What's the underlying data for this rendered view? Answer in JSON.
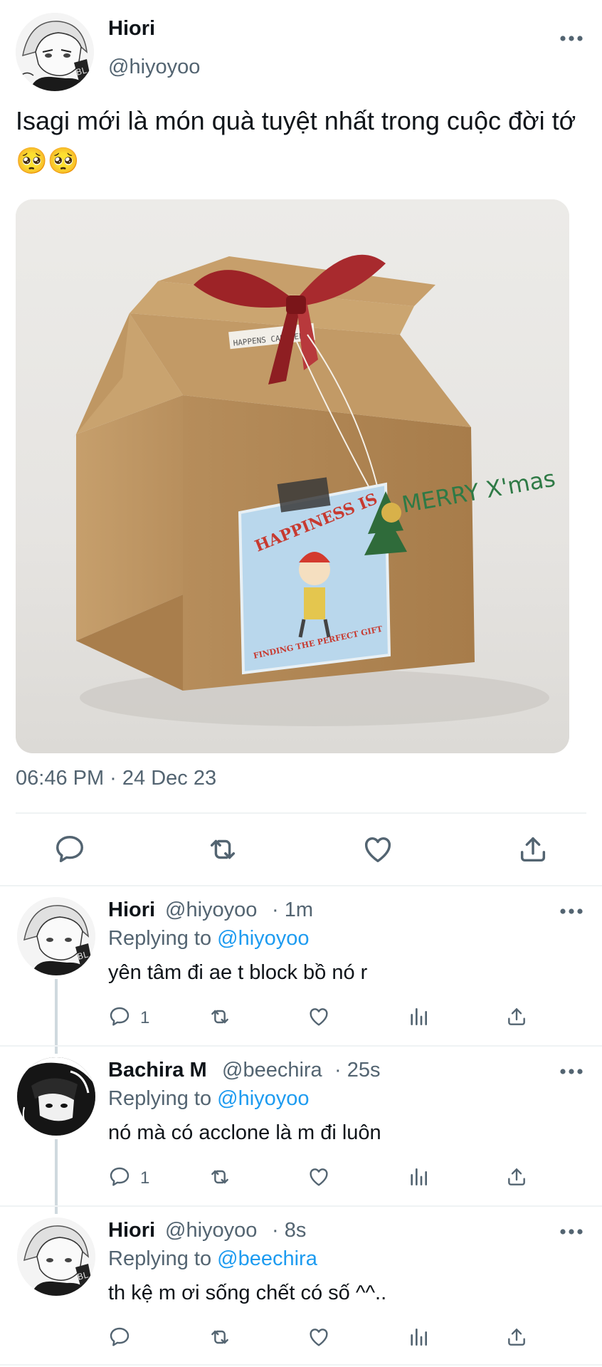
{
  "main_tweet": {
    "author_name": "Hiori",
    "author_handle": "@hiyoyoo",
    "text": "Isagi mới là món quà tuyệt nhất trong cuộc đời tớ 🥺🥺",
    "image_label": "HAPPENS CAN HELPS",
    "sticker_top": "HAPPINESS IS",
    "sticker_bottom": "FINDING THE PERFECT GIFT",
    "box_text": "MERRY X'mas",
    "timestamp": "06:46 PM · 24 Dec 23",
    "actions": [
      "reply-icon",
      "retweet-icon",
      "like-icon",
      "share-icon"
    ]
  },
  "replies": [
    {
      "name": "Hiori",
      "handle": "@hiyoyoo",
      "time": "· 1m",
      "replying_prefix": "Replying to",
      "replying_to": "@hiyoyoo",
      "text": "yên tâm đi ae t block bồ nó r",
      "reply_count": "1"
    },
    {
      "name": "Bachira M",
      "handle": "@beechira",
      "time": "· 25s",
      "replying_prefix": "Replying to",
      "replying_to": "@hiyoyoo",
      "text": "nó mà có acclone là m đi luôn",
      "reply_count": "1"
    },
    {
      "name": "Hiori",
      "handle": "@hiyoyoo",
      "time": "· 8s",
      "replying_prefix": "Replying to",
      "replying_to": "@beechira",
      "text": "th kệ m ơi sống chết có số ^^..",
      "reply_count": ""
    }
  ],
  "colors": {
    "link": "#1d9bf0",
    "secondary_text": "#536471",
    "primary_text": "#0f1419",
    "divider": "#eff3f4"
  }
}
